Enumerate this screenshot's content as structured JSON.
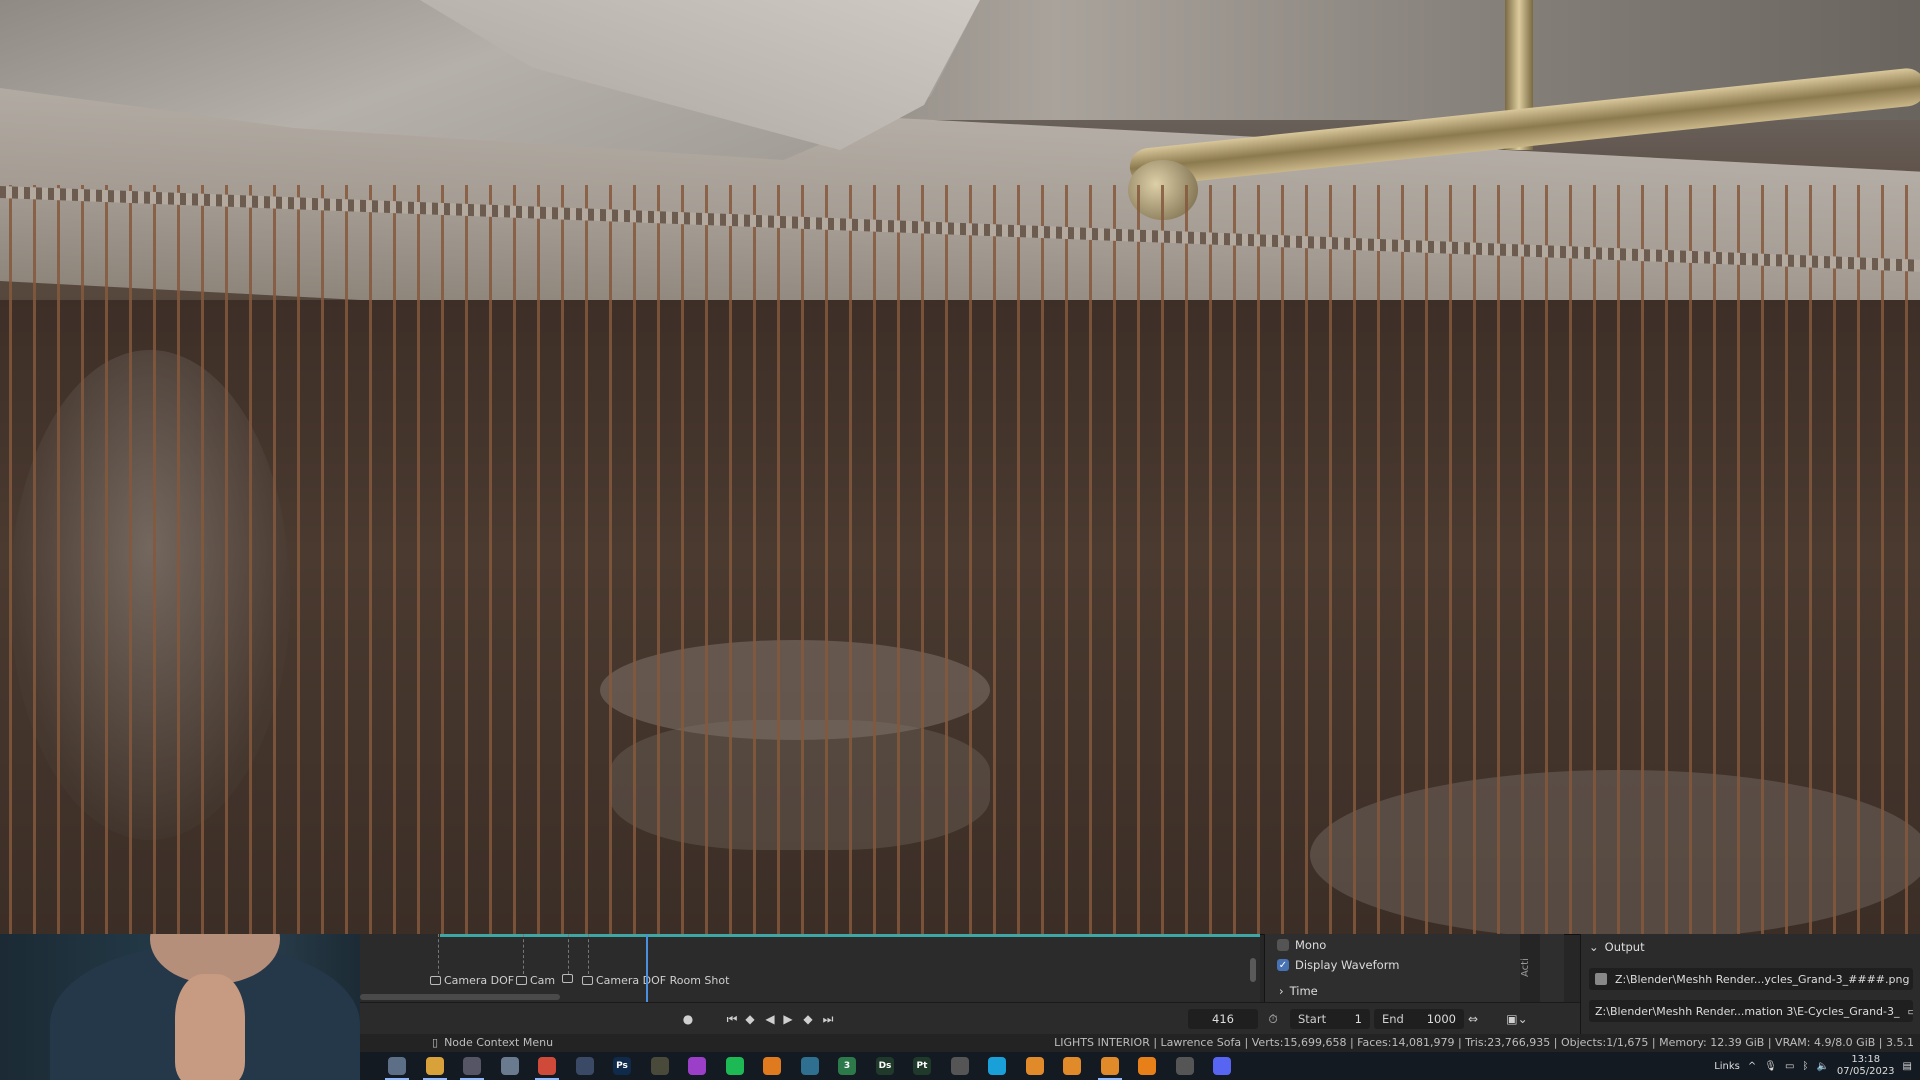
{
  "sequencer": {
    "markers": [
      {
        "label": "Camera DOF"
      },
      {
        "label": "Cam"
      },
      {
        "label": ""
      },
      {
        "label": "Camera DOF Room Shot"
      }
    ]
  },
  "properties": {
    "mono_label": "Mono",
    "mono_checked": false,
    "waveform_label": "Display Waveform",
    "waveform_checked": true,
    "time_label": "Time",
    "side_tab_label": "Acti"
  },
  "output": {
    "header": "Output",
    "path_1": "Z:\\Blender\\Meshh Render...ycles_Grand-3_####.png",
    "path_2": "Z:\\Blender\\Meshh Render...mation 3\\E-Cycles_Grand-3_"
  },
  "timeline": {
    "current_frame": "416",
    "start_label": "Start",
    "start_value": "1",
    "end_label": "End",
    "end_value": "1000"
  },
  "status": {
    "context_menu": "Node Context Menu",
    "stats": "LIGHTS INTERIOR | Lawrence Sofa | Verts:15,699,658 | Faces:14,081,979 | Tris:23,766,935 | Objects:1/1,675 | Memory: 12.39 GiB | VRAM: 4.9/8.0 GiB | 3.5.1"
  },
  "taskbar": {
    "apps": [
      {
        "name": "blender-icon",
        "glyph": "",
        "color": "#5c6f87"
      },
      {
        "name": "file-explorer-icon",
        "glyph": "",
        "color": "#d9a13a"
      },
      {
        "name": "clock-app-icon",
        "glyph": "",
        "color": "#556"
      },
      {
        "name": "calculator-icon",
        "glyph": "",
        "color": "#6a7b90"
      },
      {
        "name": "chrome-icon",
        "glyph": "",
        "color": "#d04a3a"
      },
      {
        "name": "app-icon",
        "glyph": "",
        "color": "#3a4a66"
      },
      {
        "name": "photoshop-icon",
        "glyph": "Ps",
        "color": "#0f2a4a"
      },
      {
        "name": "app-icon",
        "glyph": "",
        "color": "#4a4a3a"
      },
      {
        "name": "app-icon",
        "glyph": "",
        "color": "#9b3fc8"
      },
      {
        "name": "spotify-icon",
        "glyph": "",
        "color": "#1db954"
      },
      {
        "name": "app-icon",
        "glyph": "",
        "color": "#e07a1f"
      },
      {
        "name": "app-icon",
        "glyph": "",
        "color": "#2f6f8f"
      },
      {
        "name": "app-icon",
        "glyph": "3",
        "color": "#2c7a4a"
      },
      {
        "name": "designer-icon",
        "glyph": "Ds",
        "color": "#1f3a2a"
      },
      {
        "name": "painter-icon",
        "glyph": "Pt",
        "color": "#1f3a2a"
      },
      {
        "name": "app-icon",
        "glyph": "",
        "color": "#555"
      },
      {
        "name": "app-icon",
        "glyph": "",
        "color": "#1aa0d8"
      },
      {
        "name": "blender-icon",
        "glyph": "",
        "color": "#e08a2a"
      },
      {
        "name": "blender-icon",
        "glyph": "",
        "color": "#e08a2a"
      },
      {
        "name": "blender-icon",
        "glyph": "",
        "color": "#e08a2a"
      },
      {
        "name": "vlc-icon",
        "glyph": "",
        "color": "#e8801a"
      },
      {
        "name": "sync-icon",
        "glyph": "",
        "color": "#555"
      },
      {
        "name": "discord-icon",
        "glyph": "",
        "color": "#5865f2"
      }
    ],
    "tray_links": "Links",
    "time": "13:18",
    "date": "07/05/2023"
  }
}
